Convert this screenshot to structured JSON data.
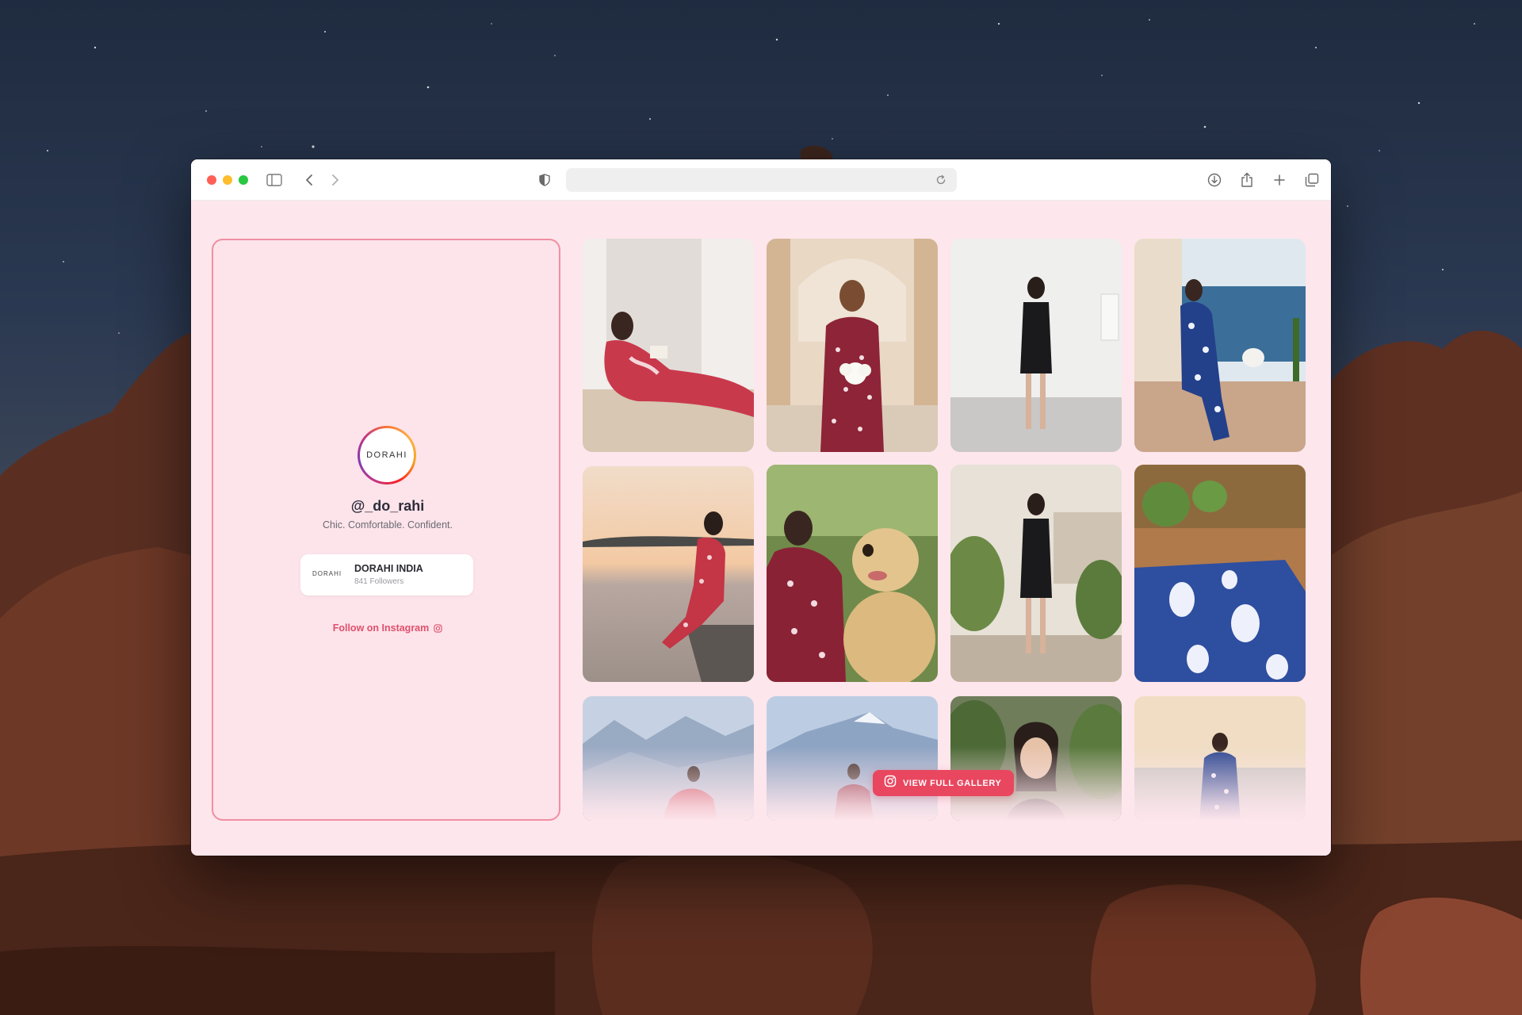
{
  "browser": {
    "address_value": "",
    "colors": {
      "close": "#ff5f57",
      "minimize": "#febc2e",
      "zoom": "#28c840"
    },
    "icons": [
      "sidebar-icon",
      "back-icon",
      "forward-icon",
      "shield-icon",
      "reload-icon",
      "download-icon",
      "share-icon",
      "new-tab-icon",
      "tabs-overview-icon"
    ]
  },
  "profile": {
    "avatar_logo": "DORAHI",
    "handle": "@_do_rahi",
    "tagline": "Chic. Comfortable. Confident.",
    "card": {
      "logo": "DORAHI",
      "name": "DORAHI INDIA",
      "followers": "841 Followers"
    },
    "follow_label": "Follow on Instagram"
  },
  "gallery": {
    "button_label": "VIEW FULL GALLERY",
    "accent": "#e8475f",
    "photos": [
      "woman reading on bed in red print loungewear",
      "smiling woman holding white flowers in maroon kurta",
      "woman in black dress in white gallery",
      "woman in blue print set on balcony with cat",
      "woman in red print set on dock at sunset",
      "woman in maroon print hugging golden retriever",
      "woman in black dress on garden terrace",
      "blue and white print fabric on wooden table",
      "woman in red print with mountain view",
      "woman in maroon print with snowy mountains",
      "woman in black top among plants",
      "woman in blue print on beach"
    ]
  }
}
